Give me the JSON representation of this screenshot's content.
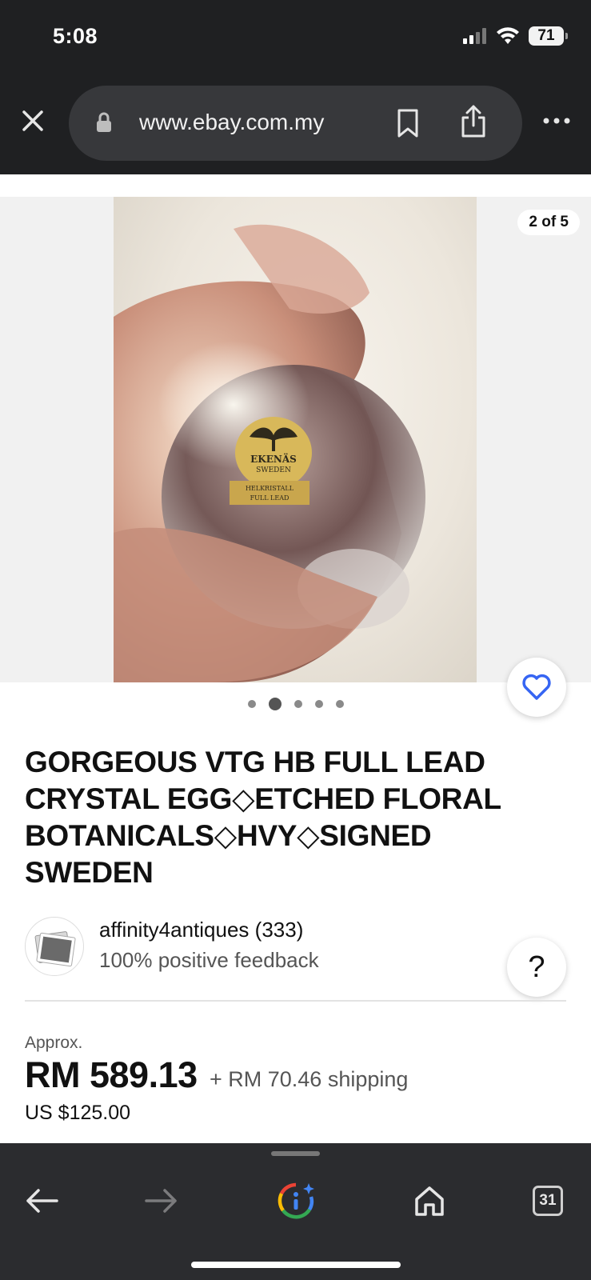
{
  "status_bar": {
    "time": "5:08",
    "battery": "71"
  },
  "browser": {
    "url": "www.ebay.com.my"
  },
  "gallery": {
    "counter": "2 of 5",
    "dot_count": 5,
    "active_index": 1,
    "photo_label": {
      "brand": "EKENÄS",
      "country": "SWEDEN",
      "line1": "HELKRISTALL",
      "line2": "FULL LEAD"
    }
  },
  "listing": {
    "title": "GORGEOUS VTG HB FULL LEAD CRYSTAL EGG◇ETCHED FLORAL BOTANICALS◇HVY◇SIGNED SWEDEN"
  },
  "seller": {
    "name": "affinity4antiques (333)",
    "feedback": "100% positive feedback"
  },
  "help": {
    "label": "?"
  },
  "price": {
    "approx_label": "Approx.",
    "main": "RM 589.13",
    "shipping": "+ RM 70.46 shipping",
    "usd": "US $125.00"
  },
  "toolbar": {
    "tabs_count": "31"
  },
  "colors": {
    "accent": "#3665f3",
    "chrome_dark": "#1f2022"
  }
}
